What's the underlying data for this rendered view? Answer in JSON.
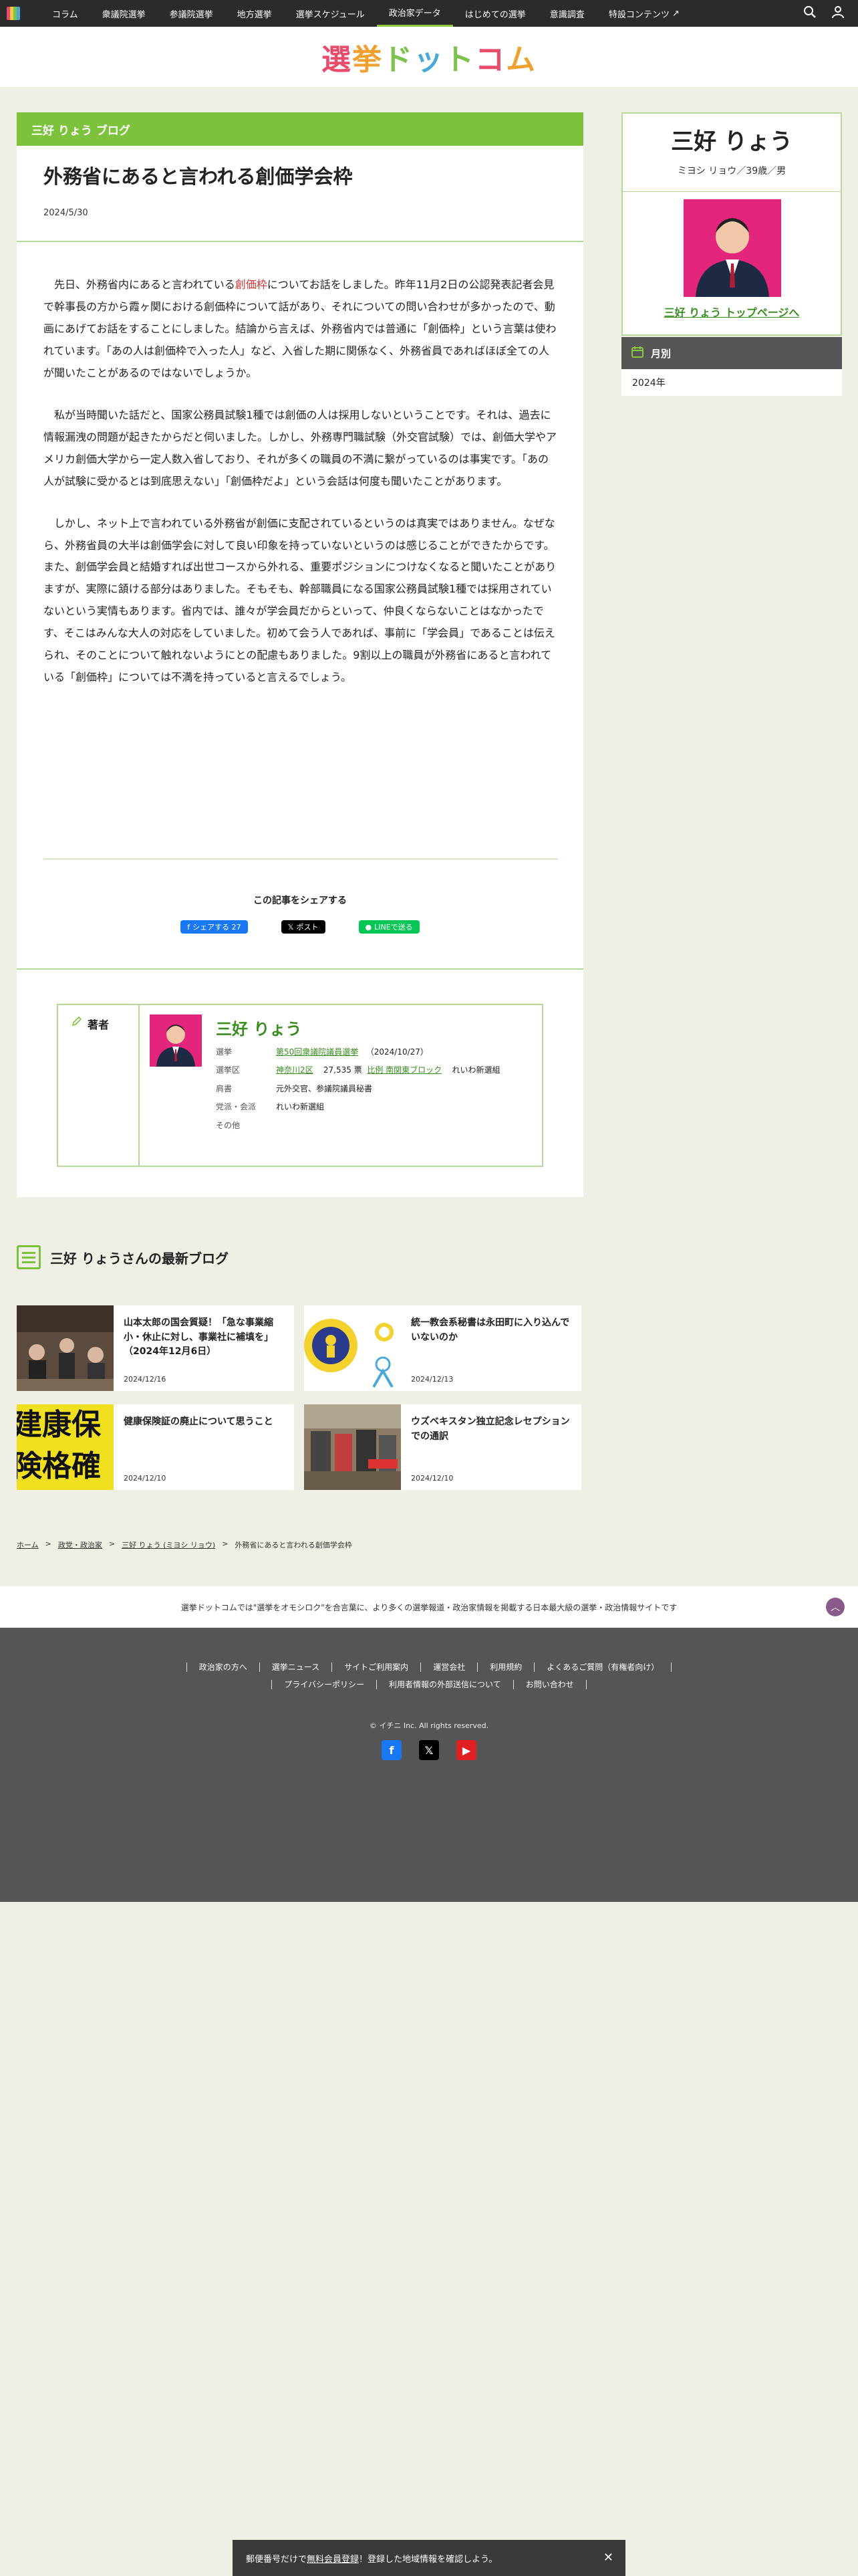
{
  "nav": {
    "items": [
      "コラム",
      "衆議院選挙",
      "参議院選挙",
      "地方選挙",
      "選挙スケジュール",
      "政治家データ",
      "はじめての選挙",
      "意識調査",
      "特設コンテンツ"
    ],
    "active_index": 5
  },
  "brand": {
    "logo_text": "選挙ドットコム"
  },
  "article": {
    "blog_label": "三好 りょう ブログ",
    "title": "外務省にあると言われる創価学会枠",
    "date": "2024/5/30",
    "p1_a": "先日、外務省内にあると言われている",
    "p1_hl": "創価枠",
    "p1_b": "についてお話をしました。昨年11月2日の公認発表記者会見で幹事長の方から霞ヶ関における創価枠について話があり、それについての問い合わせが多かったので、動画にあげてお話をすることにしました。結論から言えば、外務省内では普通に「創価枠」という言葉は使われています。「あの人は創価枠で入った人」など、入省した期に関係なく、外務省員であればほぼ全ての人が聞いたことがあるのではないでしょうか。",
    "p2": "私が当時聞いた話だと、国家公務員試験1種では創価の人は採用しないということです。それは、過去に情報漏洩の問題が起きたからだと伺いました。しかし、外務専門職試験（外交官試験）では、創価大学やアメリカ創価大学から一定人数入省しており、それが多くの職員の不満に繋がっているのは事実です。「あの人が試験に受かるとは到底思えない」「創価枠だよ」という会話は何度も聞いたことがあります。",
    "p3": "しかし、ネット上で言われている外務省が創価に支配されているというのは真実ではありません。なぜなら、外務省員の大半は創価学会に対して良い印象を持っていないというのは感じることができたからです。また、創価学会員と結婚すれば出世コースから外れる、重要ポジションにつけなくなると聞いたことがありますが、実際に頷ける部分はありました。そもそも、幹部職員になる国家公務員試験1種では採用されていないという実情もあります。省内では、誰々が学会員だからといって、仲良くならないことはなかったです、そこはみんな大人の対応をしていました。初めて会う人であれば、事前に「学会員」であることは伝えられ、そのことについて触れないようにとの配慮もありました。9割以上の職員が外務省にあると言われている「創価枠」については不満を持っていると言えるでしょう。",
    "share_title": "この記事をシェアする",
    "share_fb": "シェアする 27",
    "share_x": "ポスト",
    "share_line": "LINEで送る"
  },
  "author": {
    "label": "著者",
    "name": "三好 りょう",
    "rows": [
      {
        "k": "選挙",
        "v_link": "第50回衆議院議員選挙",
        "v_rest": "（2024/10/27）"
      },
      {
        "k": "選挙区",
        "v_link": "神奈川2区",
        "v_rest": "27,535 票",
        "v_link2": "比例 南関東ブロック",
        "v_rest2": "れいわ新選組"
      },
      {
        "k": "肩書",
        "v": "元外交官、参議院議員秘書"
      },
      {
        "k": "党派・会派",
        "v": "れいわ新選組"
      },
      {
        "k": "その他",
        "v": ""
      }
    ]
  },
  "sidebar": {
    "name": "三好 りょう",
    "kana": "ミヨシ リョウ／39歳／男",
    "top_link": "三好 りょう トップページへ",
    "month_head": "月別",
    "month_item": "2024年"
  },
  "latest": {
    "title": "三好 りょうさんの最新ブログ",
    "cards": [
      {
        "title": "山本太郎の国会質疑！「急な事業縮小・休止に対し、事業社に補填を」（2024年12月6日）",
        "date": "2024/12/16"
      },
      {
        "title": "統一教会系秘書は永田町に入り込んでいないのか",
        "date": "2024/12/13"
      },
      {
        "title": "健康保険証の廃止について思うこと",
        "date": "2024/12/10"
      },
      {
        "title": "ウズベキスタン独立記念レセプションでの通訳",
        "date": "2024/12/10"
      }
    ],
    "thumb3_text": "建康保険格確認"
  },
  "breadcrumb": [
    "ホーム",
    "政党・政治家",
    "三好 りょう (ミヨシ リョウ)",
    "外務省にあると言われる創価学会枠"
  ],
  "footer": {
    "message": "選挙ドットコムでは\"選挙をオモシロク\"を合言葉に、より多くの選挙報道・政治家情報を掲載する日本最大級の選挙・政治情報サイトです",
    "links_row1": [
      "政治家の方へ",
      "選挙ニュース",
      "サイトご利用案内",
      "運営会社",
      "利用規約",
      "よくあるご質問（有権者向け）"
    ],
    "links_row2": [
      "プライバシーポリシー",
      "利用者情報の外部送信について",
      "お問い合わせ"
    ],
    "copyright": "© イチニ Inc. All rights reserved."
  },
  "banner": {
    "pre": "郵便番号だけで",
    "link": "無料会員登録",
    "post": "！登録した地域情報を確認しよう。"
  },
  "colors": {
    "accent_green": "#7dc23d",
    "photo_pink": "#e3267b",
    "nav_bg": "#2b2b2b"
  }
}
